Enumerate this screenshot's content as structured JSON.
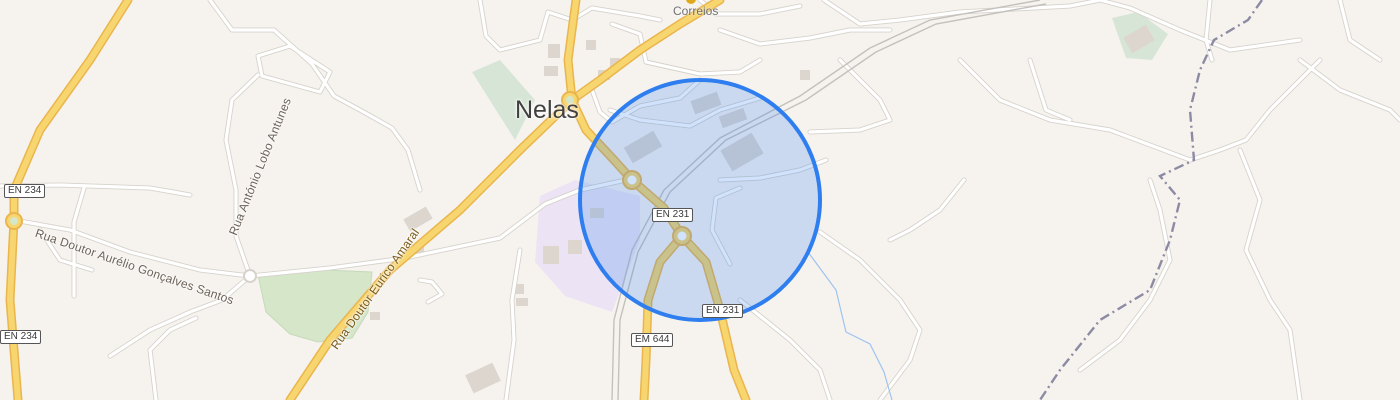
{
  "map": {
    "place": "Nelas",
    "poi": {
      "label": "Correios",
      "icon": "post-office-icon"
    },
    "streets": [
      "Rua Doutor Aurélio Gonçalves Santos",
      "Rua António Lobo Antunes",
      "Rua Doutor Eurico Amaral"
    ],
    "shields": [
      "EN 234",
      "EN 234",
      "EN 231",
      "EN 231",
      "EM 644"
    ],
    "location_marker": {
      "icon": "accuracy-circle-icon",
      "fill": "#c5d8f4",
      "stroke": "#2f7ef0"
    },
    "colors": {
      "background": "#f6f3ef",
      "major_road": "#f7d56f",
      "minor_road": "#ffffff",
      "border": "#8d8ba3",
      "water": "#9ec3ef",
      "park": "#d5e6c9"
    }
  }
}
